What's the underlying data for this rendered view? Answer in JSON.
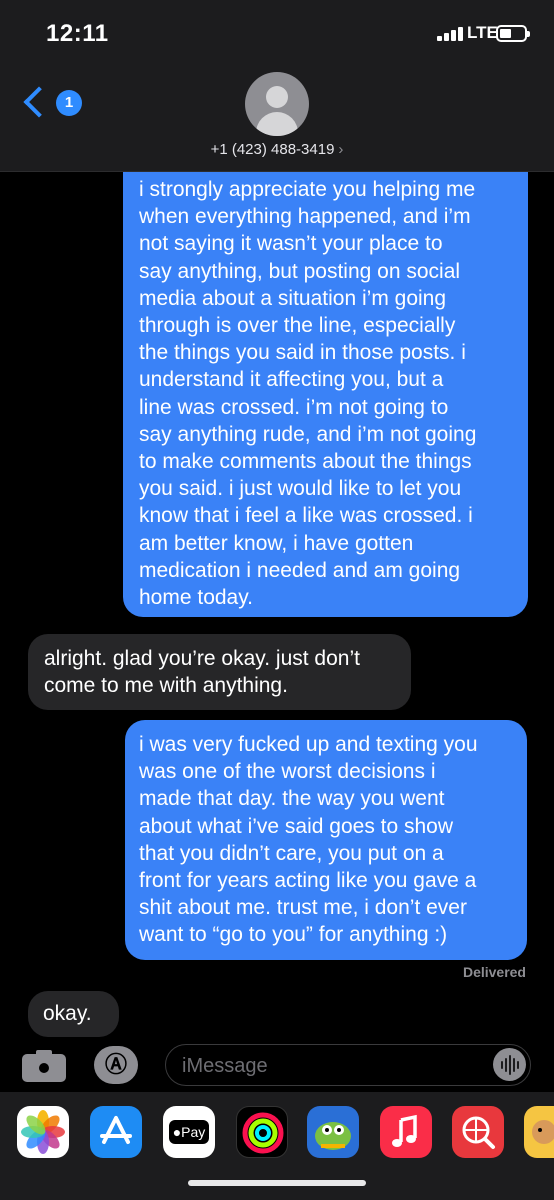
{
  "status_bar": {
    "time": "12:11",
    "network": "LTE"
  },
  "nav": {
    "back_badge": "1",
    "contact": "+1 (423) 488-3419",
    "contact_caret": "›"
  },
  "messages": [
    {
      "from": "me",
      "lines": [
        "i strongly appreciate you helping me",
        "when everything happened, and i’m",
        "not saying it wasn’t your place to",
        "say anything, but posting on social",
        "media about a situation i’m going",
        "through is over the line, especially",
        "the things you said in those posts. i",
        "understand it affecting you, but a",
        "line was crossed. i’m not going to",
        "say anything rude, and i’m not going",
        "to make comments about the things",
        "you said. i just would like to let you",
        "know that i feel a like was crossed. i",
        "am better know, i have gotten",
        "medication i needed and am going",
        "home today."
      ]
    },
    {
      "from": "them",
      "lines": [
        "alright. glad you’re okay. just don’t",
        "come to me with anything."
      ]
    },
    {
      "from": "me",
      "lines": [
        "i was very fucked up and texting you",
        "was one of the worst decisions i",
        "made that day. the way you went",
        "about what i’ve said goes to show",
        "that you didn’t care, you put on a",
        "front for years acting like you gave a",
        "shit about me. trust me, i don’t ever",
        "want to “go to you” for anything :)"
      ]
    },
    {
      "from": "them",
      "lines": [
        "okay."
      ]
    }
  ],
  "delivered_label": "Delivered",
  "input": {
    "placeholder": "iMessage"
  },
  "app_strip": [
    {
      "name": "photos-app",
      "icon": "photos-icon"
    },
    {
      "name": "app-store-app",
      "icon": "app-store-icon"
    },
    {
      "name": "apple-pay-app",
      "icon": "apple-pay-icon",
      "label": "Pay"
    },
    {
      "name": "fitness-app",
      "icon": "activity-rings-icon"
    },
    {
      "name": "game-app",
      "icon": "game-icon"
    },
    {
      "name": "music-app",
      "icon": "music-note-icon"
    },
    {
      "name": "search-images-app",
      "icon": "globe-search-icon"
    },
    {
      "name": "memoji-app",
      "icon": "memoji-icon"
    }
  ],
  "colors": {
    "sent_bubble": "#3a82f7",
    "received_bubble": "#262628",
    "accent": "#2f8cff"
  }
}
